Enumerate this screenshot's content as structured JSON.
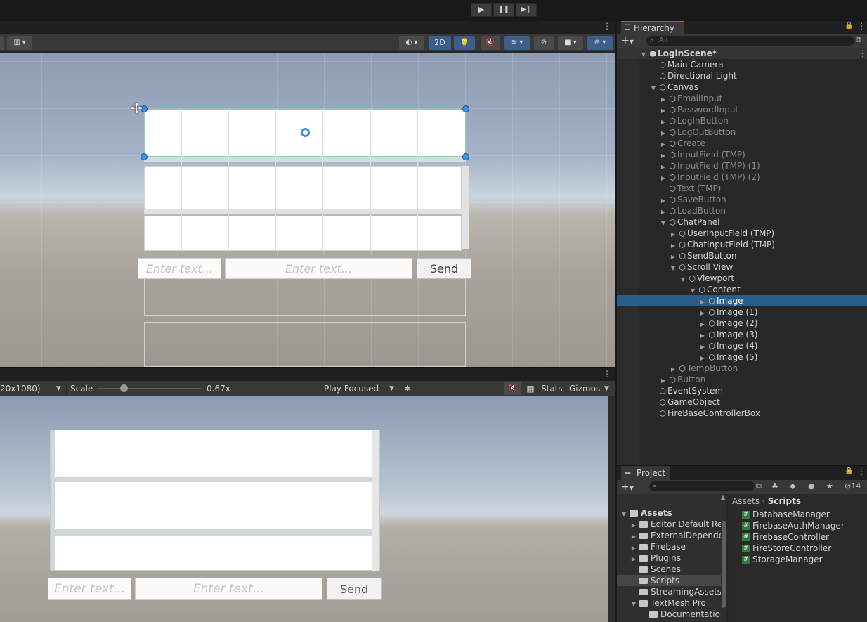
{
  "playbar": {
    "play": "▶",
    "pause": "❚❚",
    "step": "▶❘"
  },
  "scene": {
    "mode_2d": "2D",
    "input_placeholder": "Enter text...",
    "send_label": "Send"
  },
  "game": {
    "resolution": "20x1080)",
    "scale_label": "Scale",
    "scale_value": "0.67x",
    "scale_slider_fraction": 0.25,
    "play_mode": "Play Focused",
    "stats_label": "Stats",
    "gizmos_label": "Gizmos",
    "input_placeholder": "Enter text...",
    "send_label": "Send"
  },
  "hierarchy": {
    "tab_label": "Hierarchy",
    "search_placeholder": "All",
    "scene_name": "LoginScene*",
    "items": [
      {
        "label": "Main Camera"
      },
      {
        "label": "Directional Light"
      },
      {
        "label": "Canvas"
      },
      {
        "label": "EmailInput"
      },
      {
        "label": "PasswordInput"
      },
      {
        "label": "LogInButton"
      },
      {
        "label": "LogOutButton"
      },
      {
        "label": "Create"
      },
      {
        "label": "InputField (TMP)"
      },
      {
        "label": "InputField (TMP) (1)"
      },
      {
        "label": "InputField (TMP) (2)"
      },
      {
        "label": "Text (TMP)"
      },
      {
        "label": "SaveButton"
      },
      {
        "label": "LoadButton"
      },
      {
        "label": "ChatPanel"
      },
      {
        "label": "UserInputField (TMP)"
      },
      {
        "label": "ChatInputField (TMP)"
      },
      {
        "label": "SendButton"
      },
      {
        "label": "Scroll View"
      },
      {
        "label": "Viewport"
      },
      {
        "label": "Content"
      },
      {
        "label": "Image"
      },
      {
        "label": "Image (1)"
      },
      {
        "label": "Image (2)"
      },
      {
        "label": "Image (3)"
      },
      {
        "label": "Image (4)"
      },
      {
        "label": "Image (5)"
      },
      {
        "label": "TempButton"
      },
      {
        "label": "Button"
      },
      {
        "label": "EventSystem"
      },
      {
        "label": "GameObject"
      },
      {
        "label": "FireBaseControllerBox"
      }
    ]
  },
  "project": {
    "tab_label": "Project",
    "hidden_count": "14",
    "breadcrumb": [
      "Assets",
      "Scripts"
    ],
    "tree": [
      {
        "label": "Assets"
      },
      {
        "label": "Editor Default Res"
      },
      {
        "label": "ExternalDepende"
      },
      {
        "label": "Firebase"
      },
      {
        "label": "Plugins"
      },
      {
        "label": "Scenes"
      },
      {
        "label": "Scripts"
      },
      {
        "label": "StreamingAssets"
      },
      {
        "label": "TextMesh Pro"
      },
      {
        "label": "Documentatior"
      }
    ],
    "files": [
      {
        "label": "DatabaseManager"
      },
      {
        "label": "FirebaseAuthManager"
      },
      {
        "label": "FirebaseController"
      },
      {
        "label": "FireStoreController"
      },
      {
        "label": "StorageManager"
      }
    ]
  }
}
